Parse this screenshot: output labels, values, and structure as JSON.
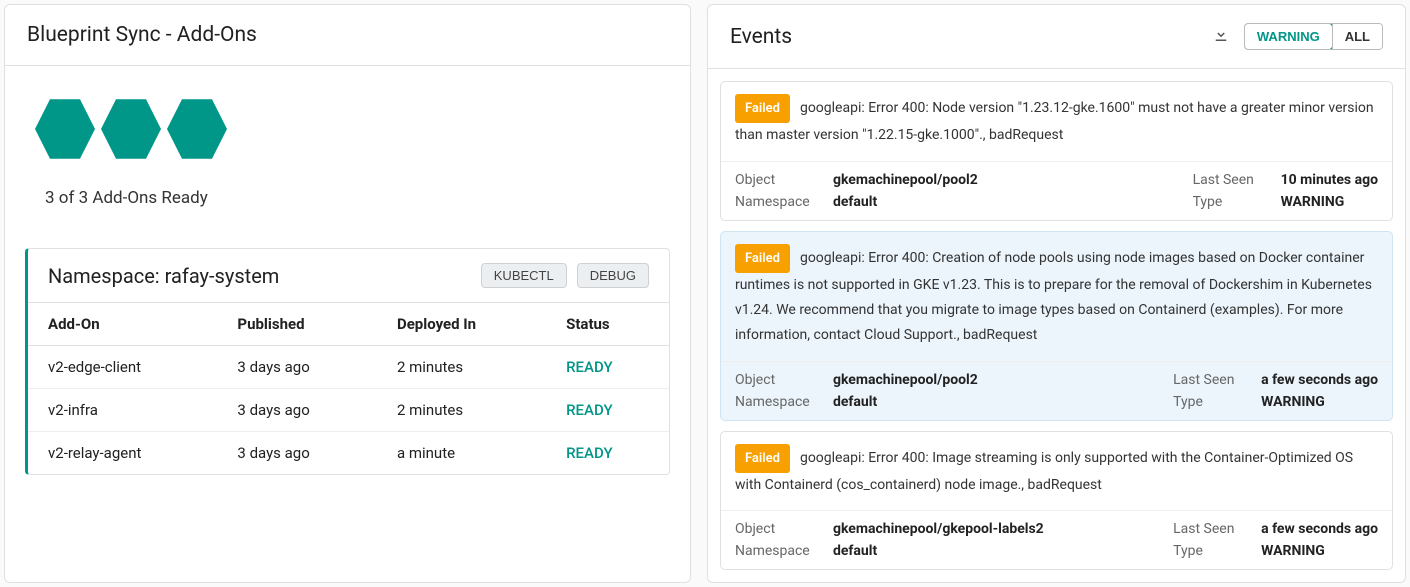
{
  "left": {
    "title": "Blueprint Sync - Add-Ons",
    "ready_text": "3 of 3 Add-Ons Ready",
    "hex_count": 3,
    "namespace_label": "Namespace: rafay-system",
    "kubectl_label": "KUBECTL",
    "debug_label": "DEBUG",
    "columns": {
      "addon": "Add-On",
      "published": "Published",
      "deployed": "Deployed In",
      "status": "Status"
    },
    "rows": [
      {
        "addon": "v2-edge-client",
        "published": "3 days ago",
        "deployed": "2 minutes",
        "status": "READY"
      },
      {
        "addon": "v2-infra",
        "published": "3 days ago",
        "deployed": "2 minutes",
        "status": "READY"
      },
      {
        "addon": "v2-relay-agent",
        "published": "3 days ago",
        "deployed": "a minute",
        "status": "READY"
      }
    ]
  },
  "right": {
    "title": "Events",
    "filter": {
      "warning": "WARNING",
      "all": "ALL"
    },
    "meta_labels": {
      "object": "Object",
      "namespace": "Namespace",
      "last_seen": "Last Seen",
      "type": "Type"
    },
    "events": [
      {
        "badge": "Failed",
        "message": "googleapi: Error 400: Node version \"1.23.12-gke.1600\" must not have a greater minor version than master version \"1.22.15-gke.1000\"., badRequest",
        "object": "gkemachinepool/pool2",
        "namespace": "default",
        "last_seen": "10 minutes ago",
        "type": "WARNING",
        "highlight": false
      },
      {
        "badge": "Failed",
        "message": "googleapi: Error 400: Creation of node pools using node images based on Docker container runtimes is not supported in GKE v1.23. This is to prepare for the removal of Dockershim in Kubernetes v1.24. We recommend that you migrate to image types based on Containerd (examples). For more information, contact Cloud Support., badRequest",
        "object": "gkemachinepool/pool2",
        "namespace": "default",
        "last_seen": "a few seconds ago",
        "type": "WARNING",
        "highlight": true
      },
      {
        "badge": "Failed",
        "message": "googleapi: Error 400: Image streaming is only supported with the Container-Optimized OS with Containerd (cos_containerd) node image., badRequest",
        "object": "gkemachinepool/gkepool-labels2",
        "namespace": "default",
        "last_seen": "a few seconds ago",
        "type": "WARNING",
        "highlight": false
      }
    ]
  }
}
